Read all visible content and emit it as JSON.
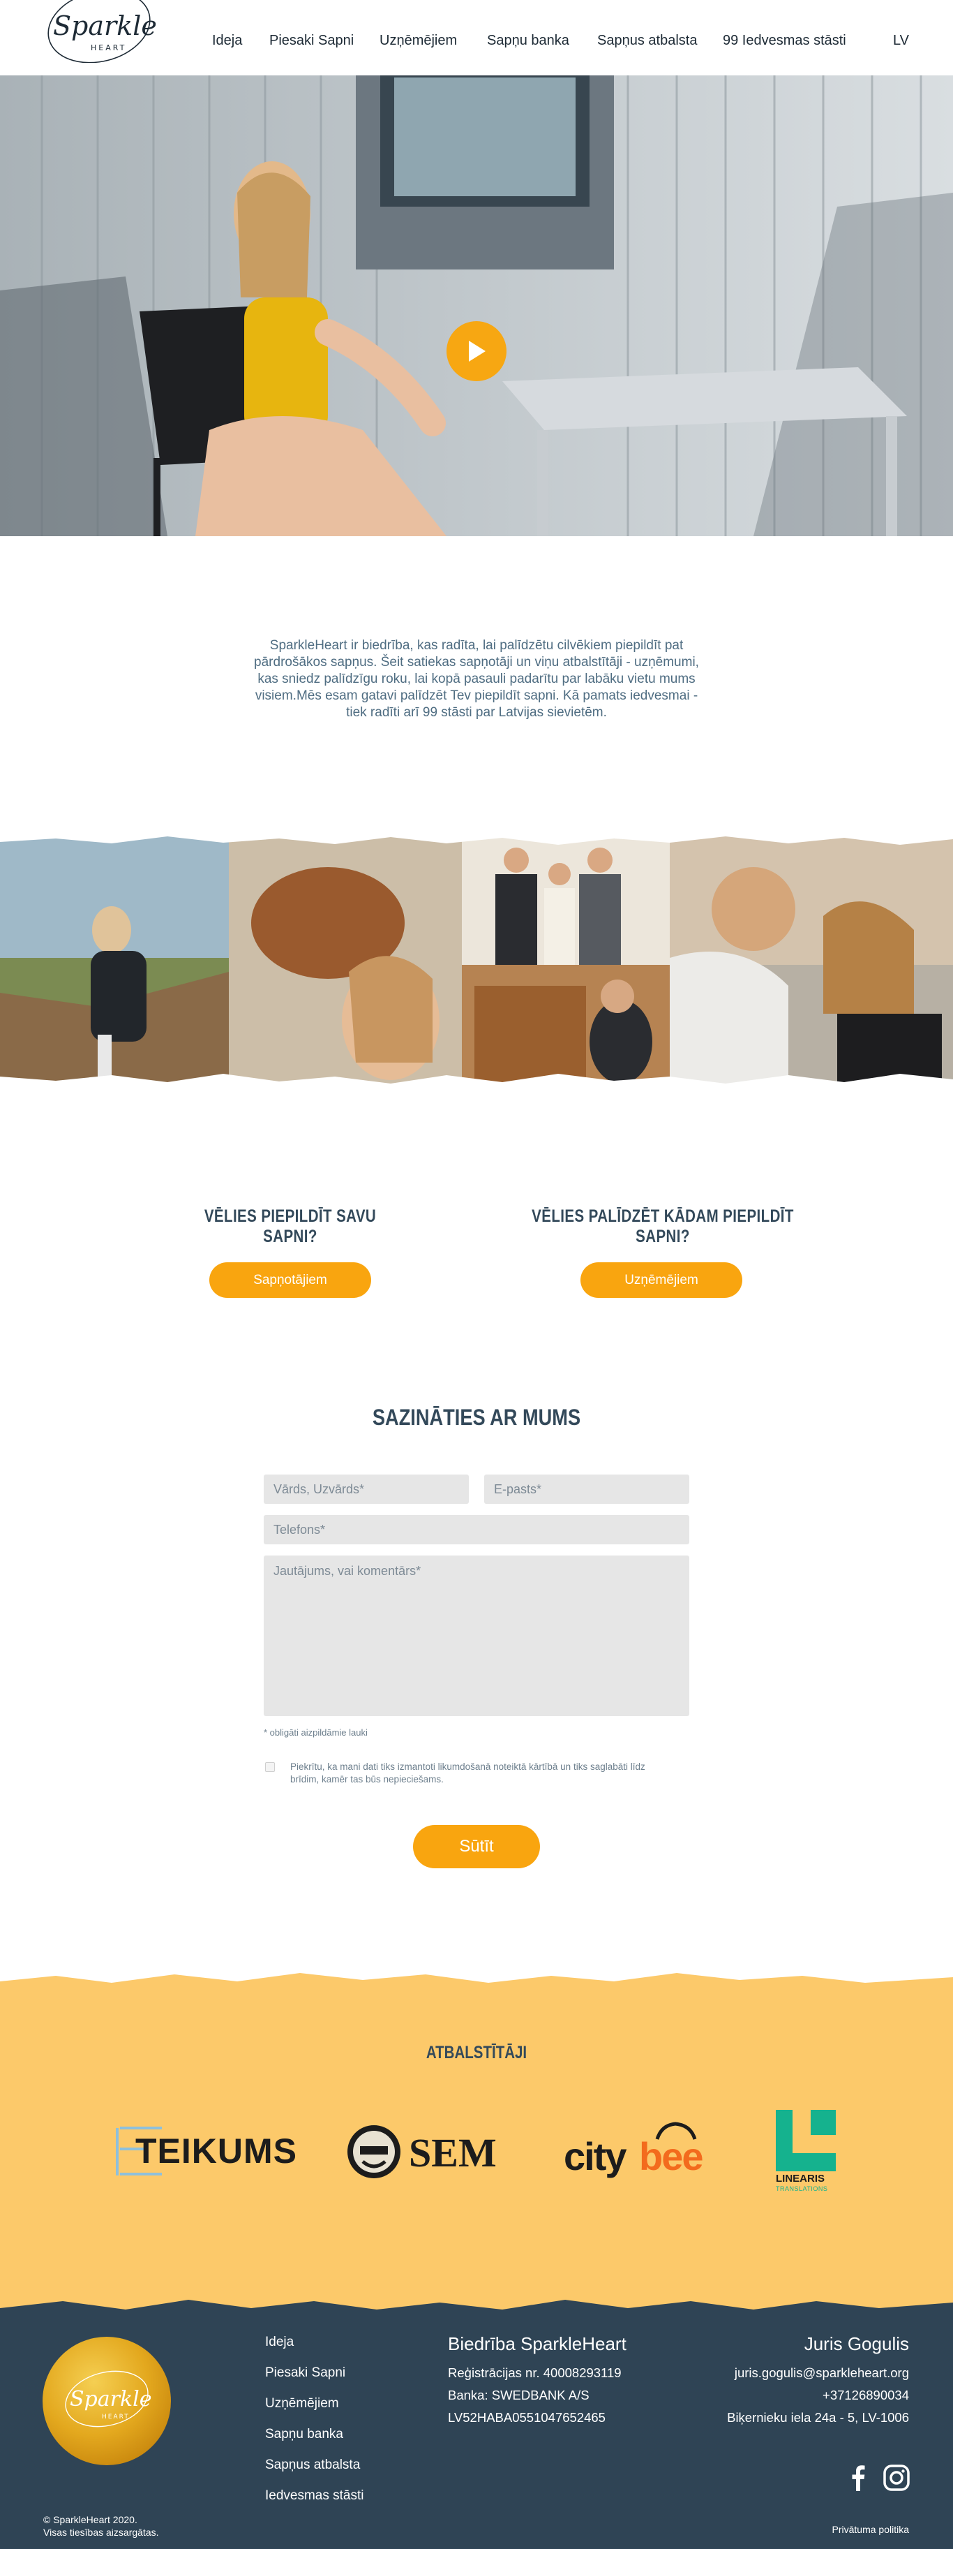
{
  "header": {
    "logo_text": "Sparkle",
    "logo_subtext": "HEART",
    "nav": [
      "Ideja",
      "Piesaki Sapni",
      "Uzņēmējiem",
      "Sapņu banka",
      "Sapņus atbalsta",
      "99 Iedvesmas stāsti"
    ],
    "language": "LV"
  },
  "intro": {
    "text": "SparkleHeart ir biedrība, kas radīta, lai palīdzētu cilvēkiem piepildīt pat pārdrošākos sapņus. Šeit satiekas sapņotāji un viņu atbalstītāji - uzņēmumi, kas sniedz palīdzīgu roku, lai kopā pasauli padarītu par labāku vietu mums visiem.Mēs esam gatavi palīdzēt Tev piepildīt sapni. Kā pamats iedvesmai - tiek radīti arī 99 stāsti par Latvijas sievietēm."
  },
  "cta": [
    {
      "title": "VĒLIES PIEPILDĪT SAVU SAPNI?",
      "button": "Sapņotājiem"
    },
    {
      "title": "VĒLIES PALĪDZĒT KĀDAM PIEPILDĪT SAPNI?",
      "button": "Uzņēmējiem"
    }
  ],
  "contact": {
    "title": "SAZINĀTIES AR MUMS",
    "name_placeholder": "Vārds, Uzvārds*",
    "email_placeholder": "E-pasts*",
    "phone_placeholder": "Telefons*",
    "message_placeholder": "Jautājums, vai komentārs*",
    "required_note": "* obligāti aizpildāmie lauki",
    "consent": "Piekrītu, ka mani dati tiks izmantoti likumdošanā noteiktā kārtībā un tiks saglabāti līdz brīdim, kamēr tas būs nepieciešams.",
    "submit": "Sūtīt"
  },
  "sponsors": {
    "title": "ATBALSTĪTĀJI",
    "logos": [
      {
        "name": "TEIKUMS"
      },
      {
        "name": "SEM"
      },
      {
        "name_part1": "city",
        "name_part2": "bee"
      },
      {
        "name": "LINEARIS",
        "sub": "TRANSLATIONS"
      }
    ]
  },
  "footer": {
    "nav": [
      "Ideja",
      "Piesaki Sapni",
      "Uzņēmējiem",
      "Sapņu banka",
      "Sapņus atbalsta",
      "Iedvesmas stāsti"
    ],
    "org_title": "Biedrība SparkleHeart",
    "org_lines": [
      "Reģistrācijas nr. 40008293119",
      "Banka: SWEDBANK A/S",
      "LV52HABA0551047652465"
    ],
    "person_title": "Juris Gogulis",
    "person_lines": [
      "juris.gogulis@sparkleheart.org",
      "+37126890034",
      "Biķernieku iela 24a - 5, LV-1006"
    ],
    "copyright_1": "© SparkleHeart 2020.",
    "copyright_2": "Visas tiesības aizsargātas.",
    "privacy": "Privātuma politika",
    "badge_text": "Sparkle",
    "badge_sub": "HEART"
  },
  "colors": {
    "accent": "#f9a50f",
    "dark": "#2f4455",
    "sponsor_bg": "#fcc96a",
    "field_bg": "#e6e6e6"
  }
}
